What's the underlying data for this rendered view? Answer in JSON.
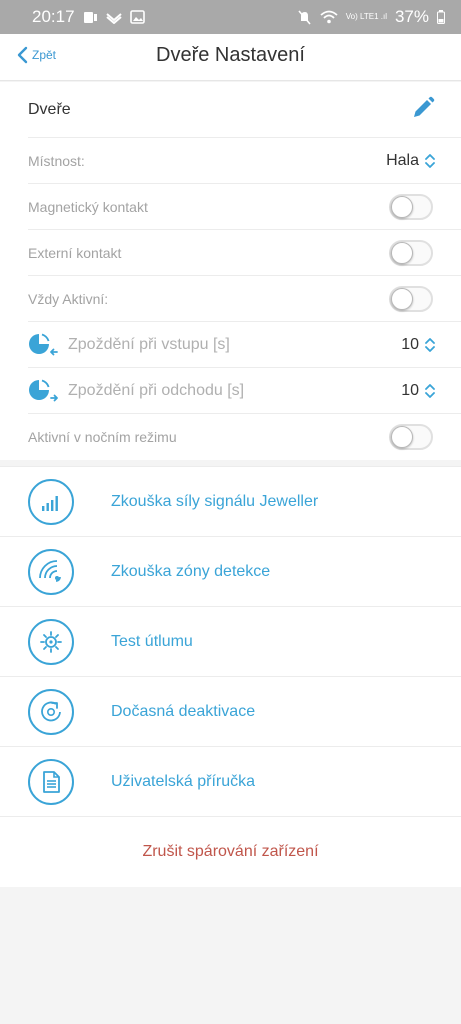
{
  "status_bar": {
    "time": "20:17",
    "carrier_label": "Vo) LTE1 .ıl",
    "battery": "37%"
  },
  "header": {
    "back_label": "Zpět",
    "title": "Dveře Nastavení"
  },
  "settings": {
    "device_name": "Dveře",
    "room_label": "Místnost:",
    "room_value": "Hala",
    "magnetic_label": "Magnetický kontakt",
    "magnetic_on": false,
    "external_label": "Externí kontakt",
    "external_on": false,
    "always_active_label": "Vždy Aktivní:",
    "always_active_on": false,
    "entry_delay_label": "Zpoždění při vstupu [s]",
    "entry_delay_value": "10",
    "exit_delay_label": "Zpoždění při odchodu [s]",
    "exit_delay_value": "10",
    "night_mode_label": "Aktivní v nočním režimu",
    "night_mode_on": false
  },
  "actions": [
    {
      "label": "Zkouška síly signálu Jeweller",
      "icon": "signal-strength-icon"
    },
    {
      "label": "Zkouška zóny detekce",
      "icon": "detection-zone-icon"
    },
    {
      "label": "Test útlumu",
      "icon": "attenuation-icon"
    },
    {
      "label": "Dočasná deaktivace",
      "icon": "temporary-deactivation-icon"
    },
    {
      "label": "Uživatelská příručka",
      "icon": "user-manual-icon"
    }
  ],
  "unpair_label": "Zrušit spárování zařízení",
  "colors": {
    "accent": "#3aa4d7",
    "danger": "#c0564b",
    "status_bar": "#a9a9a9"
  }
}
